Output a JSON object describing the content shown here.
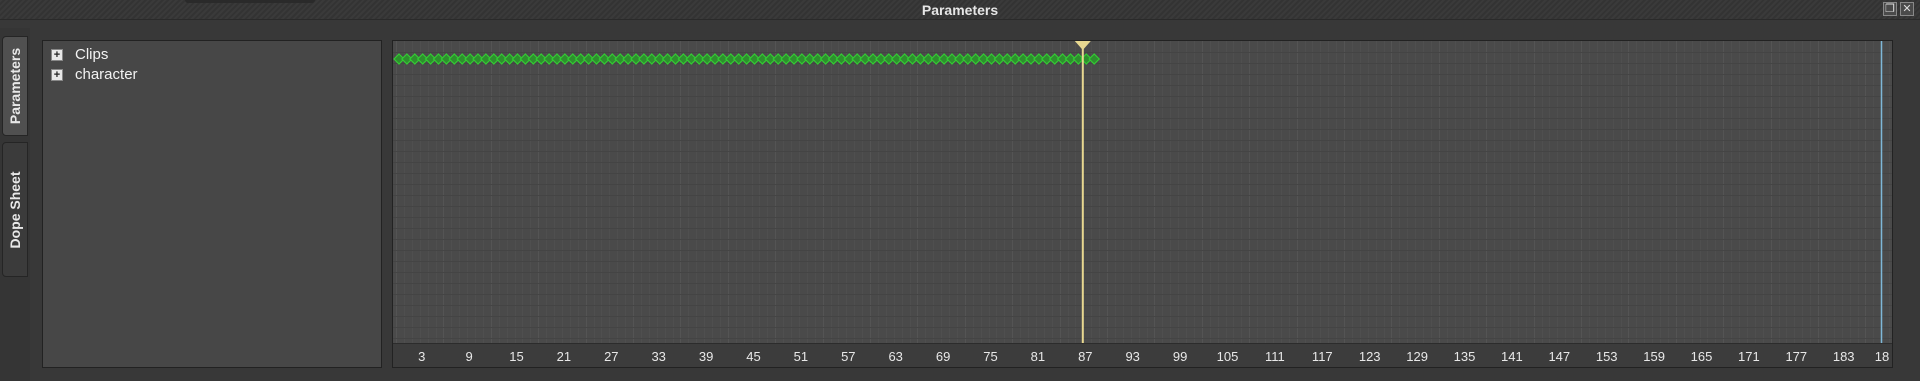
{
  "window": {
    "title": "Parameters",
    "float_icon": "float-window-icon",
    "close_icon": "close-icon"
  },
  "side_tabs": [
    {
      "label": "Parameters"
    },
    {
      "label": "Dope Sheet"
    }
  ],
  "tree": {
    "items": [
      {
        "label": "Clips",
        "expander": "+"
      },
      {
        "label": "character",
        "expander": "+"
      }
    ]
  },
  "timeline": {
    "current_frame": 87,
    "key_start_frame": 0,
    "key_end_frame": 88,
    "max_frame": 189,
    "ruler_labels": [
      "3",
      "9",
      "15",
      "21",
      "27",
      "33",
      "39",
      "45",
      "51",
      "57",
      "63",
      "69",
      "75",
      "81",
      "87",
      "93",
      "99",
      "105",
      "111",
      "117",
      "123",
      "129",
      "135",
      "141",
      "147",
      "153",
      "159",
      "165",
      "171",
      "177",
      "183",
      "18"
    ],
    "colors": {
      "keyframe": "#33cc33",
      "playhead": "#e8d890",
      "end_marker": "#7fb8d8"
    }
  }
}
